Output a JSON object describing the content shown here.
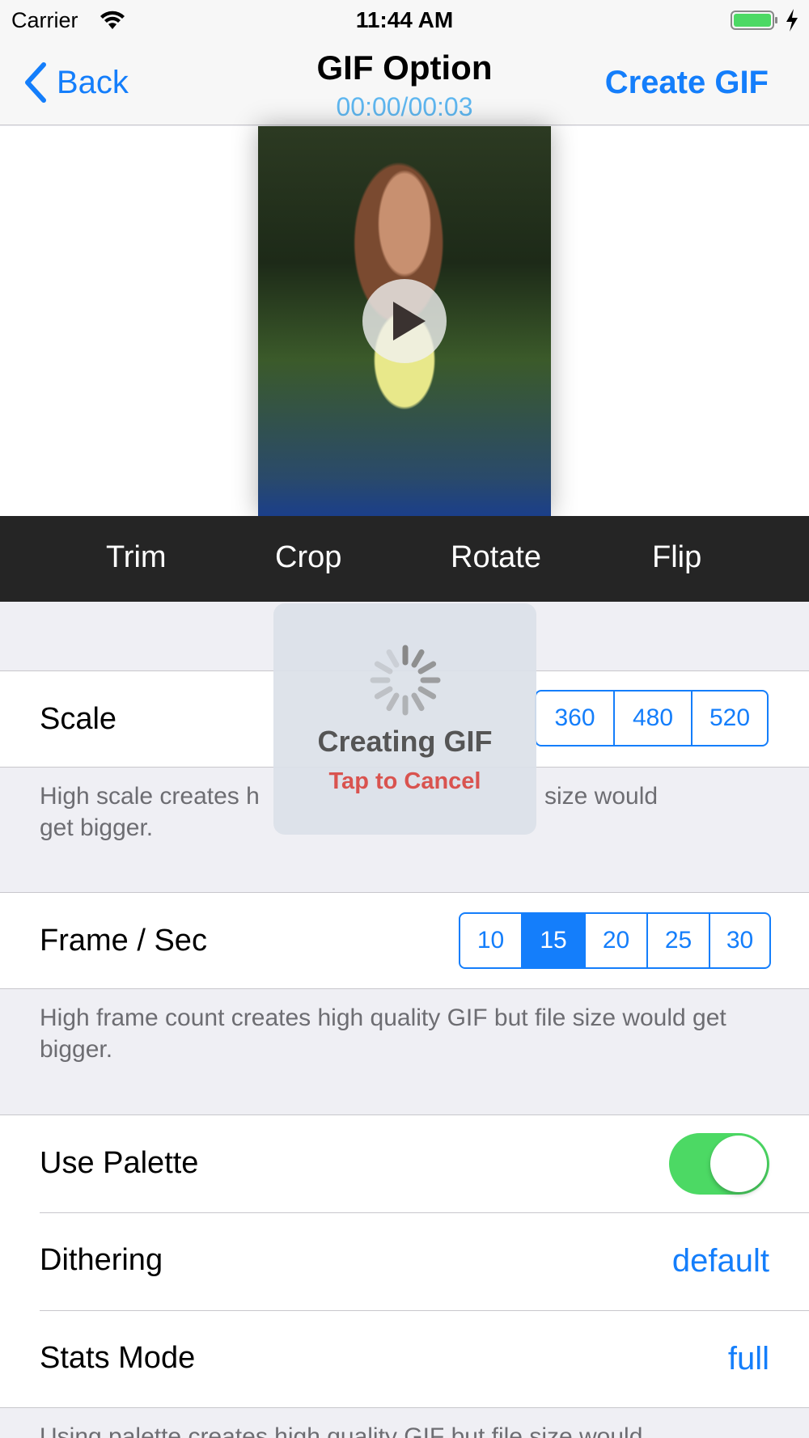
{
  "status_bar": {
    "carrier": "Carrier",
    "time": "11:44 AM"
  },
  "nav": {
    "back_label": "Back",
    "title": "GIF Option",
    "subtitle": "00:00/00:03",
    "action_label": "Create GIF"
  },
  "edit_toolbar": {
    "items": [
      "Trim",
      "Crop",
      "Rotate",
      "Flip"
    ]
  },
  "scale": {
    "label": "Scale",
    "options": [
      "360",
      "480",
      "520"
    ],
    "footer": "High scale creates h",
    "footer_tail": "size would",
    "footer_line2": "get bigger."
  },
  "frame_rate": {
    "label": "Frame / Sec",
    "options": [
      "10",
      "15",
      "20",
      "25",
      "30"
    ],
    "selected": "15",
    "footer": "High frame count creates high quality GIF but file size would get bigger."
  },
  "palette": {
    "use_palette_label": "Use Palette",
    "use_palette_on": true,
    "dithering_label": "Dithering",
    "dithering_value": "default",
    "stats_mode_label": "Stats Mode",
    "stats_mode_value": "full",
    "footer": "Using palette creates high quality GIF but file size would"
  },
  "hud": {
    "title": "Creating GIF",
    "cancel_label": "Tap to Cancel"
  },
  "colors": {
    "accent": "#147efb",
    "toggle_on": "#4cd964",
    "cancel": "#d9534f",
    "toolbar_bg": "#252525"
  }
}
